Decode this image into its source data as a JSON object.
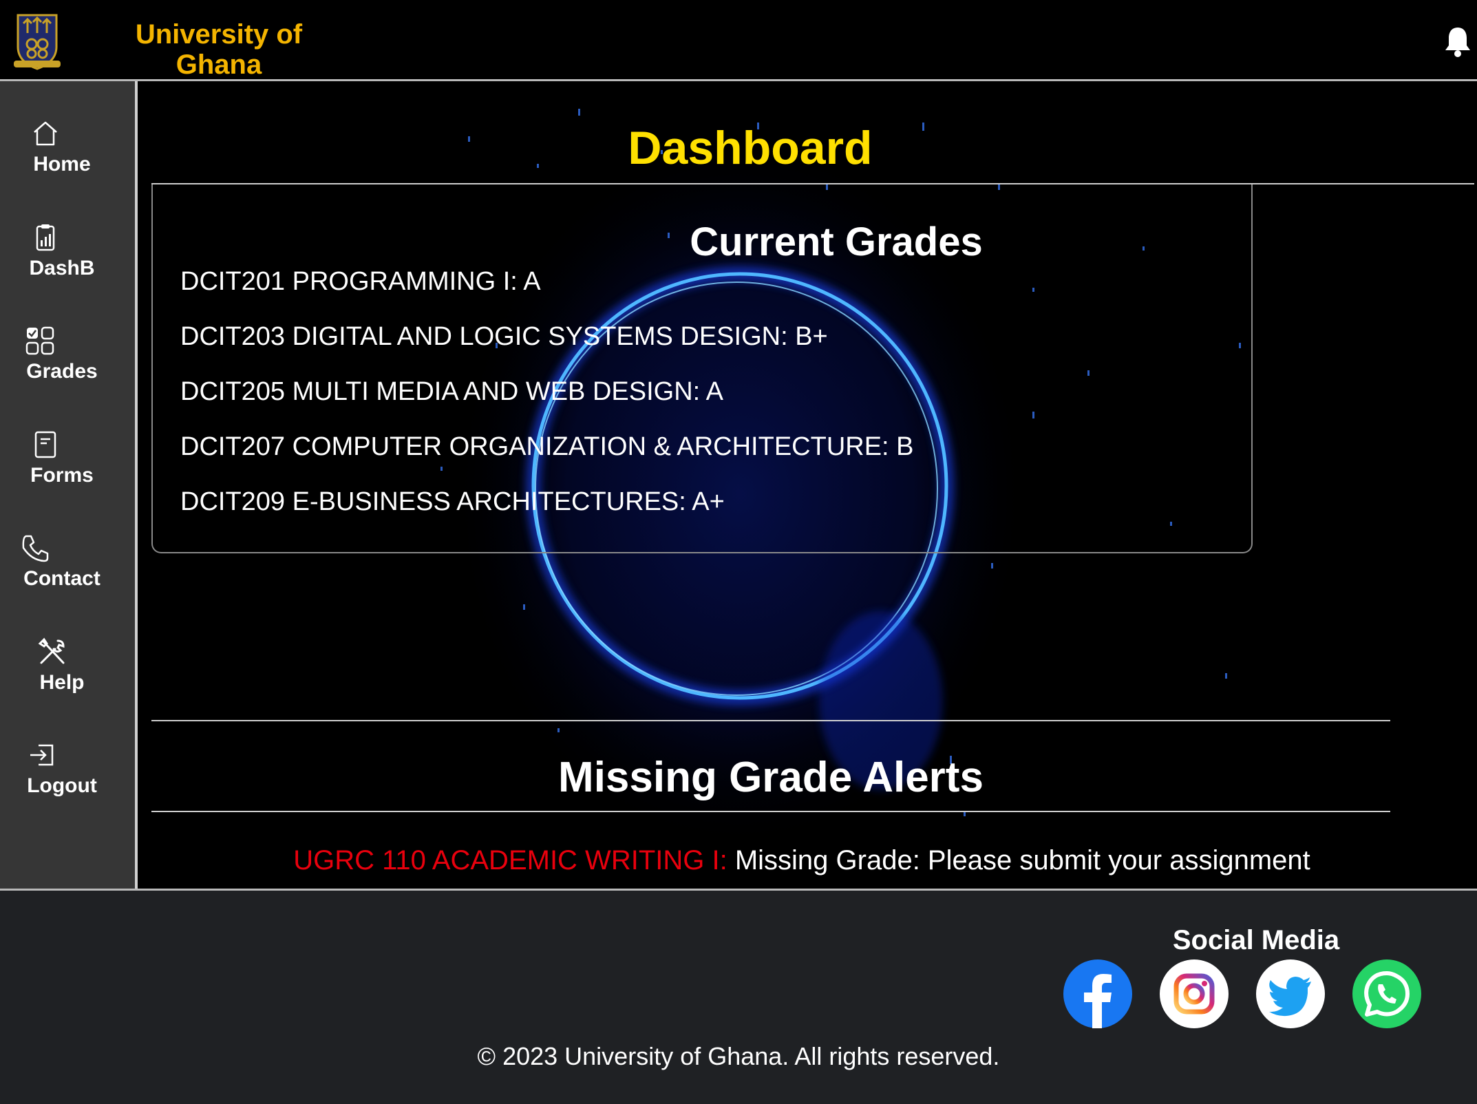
{
  "header": {
    "brand": "University of Ghana",
    "brand_color": "#f4b400"
  },
  "sidebar": {
    "items": [
      {
        "label": "Home",
        "icon": "home-icon"
      },
      {
        "label": "DashB",
        "icon": "clipboard-chart-icon"
      },
      {
        "label": "Grades",
        "icon": "grid-check-icon"
      },
      {
        "label": "Forms",
        "icon": "form-icon"
      },
      {
        "label": "Contact",
        "icon": "phone-icon"
      },
      {
        "label": "Help",
        "icon": "tools-icon"
      },
      {
        "label": "Logout",
        "icon": "logout-icon"
      }
    ]
  },
  "main": {
    "title": "Dashboard",
    "title_color": "#ffe000",
    "grades": {
      "heading": "Current Grades",
      "rows": [
        "DCIT201 PROGRAMMING I: A",
        "DCIT203 DIGITAL AND LOGIC SYSTEMS DESIGN: B+",
        "DCIT205 MULTI MEDIA AND WEB DESIGN: A",
        "DCIT207 COMPUTER ORGANIZATION & ARCHITECTURE: B",
        "DCIT209 E-BUSINESS ARCHITECTURES: A+"
      ]
    },
    "missing": {
      "heading": "Missing Grade Alerts",
      "course": "UGRC 110 ACADEMIC WRITING I:",
      "message": "Missing Grade: Please submit your assignment",
      "course_color": "#e8000d"
    }
  },
  "footer": {
    "social_title": "Social Media",
    "social": [
      {
        "name": "facebook",
        "icon": "facebook-icon",
        "color": "#1877f2"
      },
      {
        "name": "instagram",
        "icon": "instagram-icon",
        "color": "#e1306c"
      },
      {
        "name": "twitter",
        "icon": "twitter-icon",
        "color": "#1da1f2"
      },
      {
        "name": "whatsapp",
        "icon": "whatsapp-icon",
        "color": "#25d366"
      }
    ],
    "copyright": "© 2023 University of Ghana. All rights reserved."
  }
}
